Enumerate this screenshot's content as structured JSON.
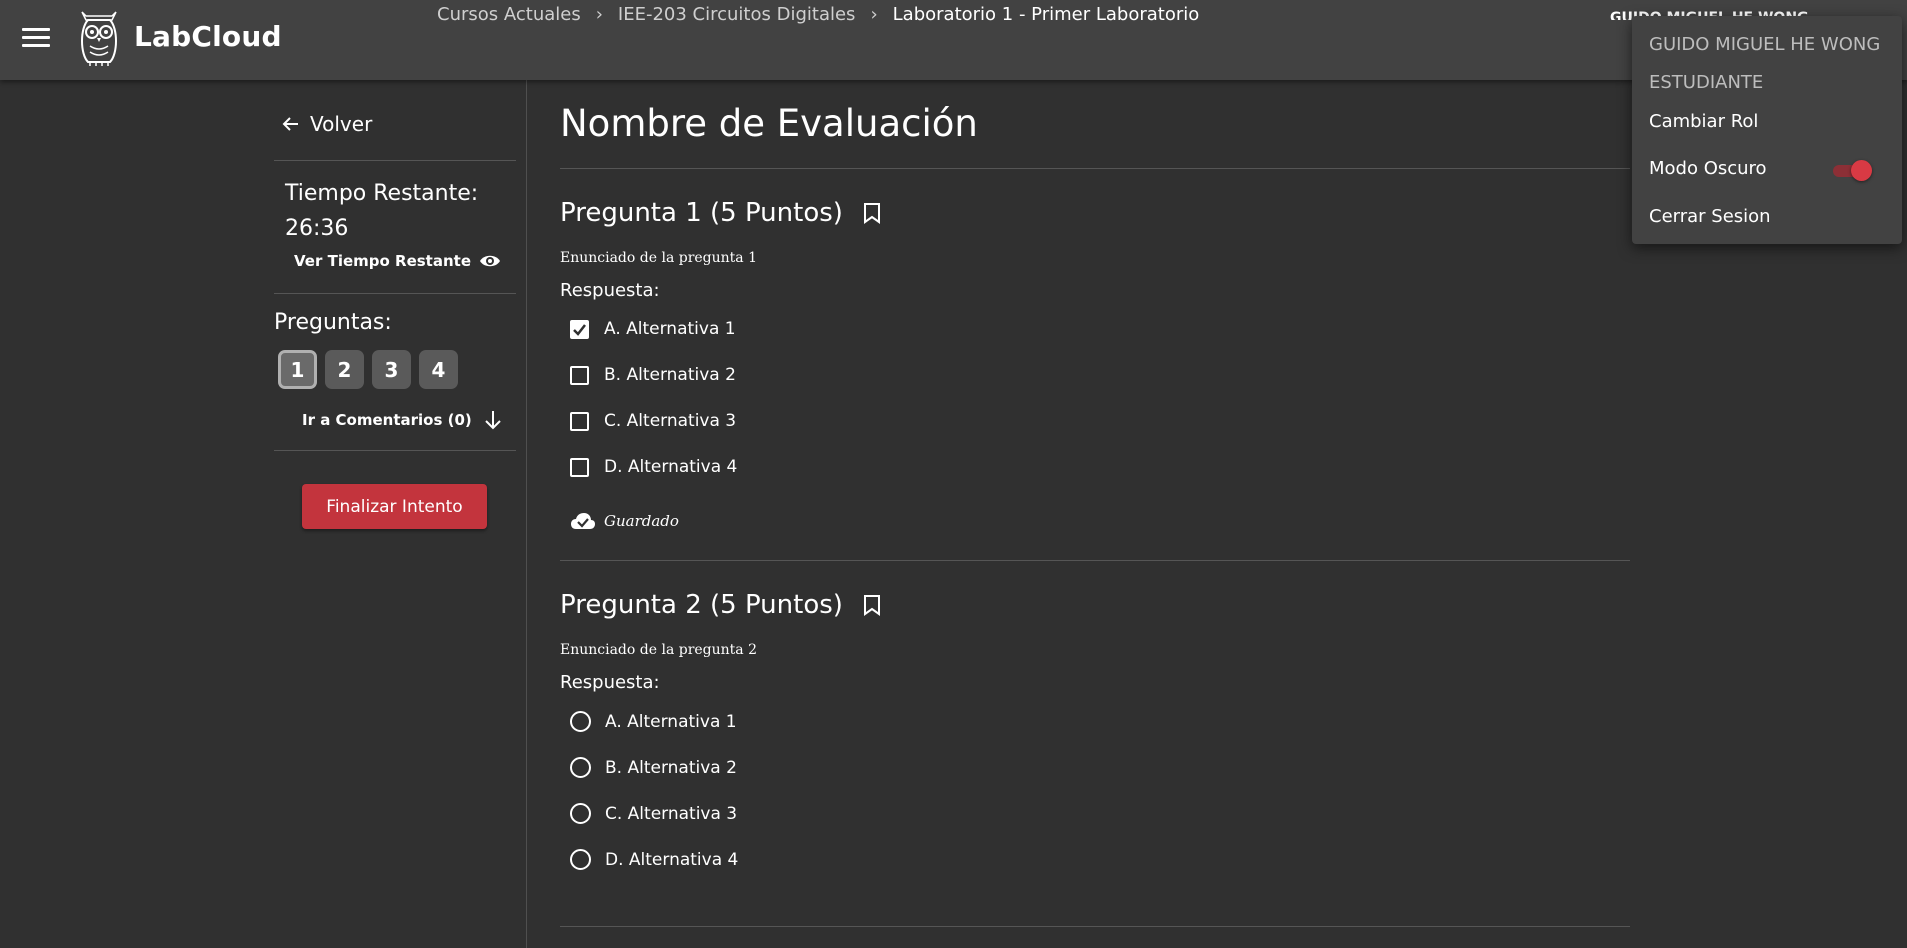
{
  "app": {
    "name": "LabCloud"
  },
  "breadcrumb": {
    "items": [
      "Cursos Actuales",
      "IEE-203 Circuitos Digitales",
      "Laboratorio 1 - Primer Laboratorio"
    ]
  },
  "header": {
    "user_name": "GUIDO MIGUEL HE WONG"
  },
  "sidebar": {
    "back_label": "Volver",
    "time_label": "Tiempo Restante:",
    "time_value": "26:36",
    "see_time_label": "Ver Tiempo Restante",
    "questions_label": "Preguntas:",
    "question_numbers": [
      "1",
      "2",
      "3",
      "4"
    ],
    "active_question": 1,
    "comments_label": "Ir a Comentarios (0)",
    "finish_label": "Finalizar Intento"
  },
  "main": {
    "title": "Nombre de Evaluación",
    "questions": [
      {
        "title": "Pregunta 1 (5 Puntos)",
        "statement": "Enunciado de la pregunta 1",
        "answer_label": "Respuesta:",
        "type": "checkbox",
        "options": [
          {
            "label": "A. Alternativa 1",
            "checked": true
          },
          {
            "label": "B. Alternativa 2",
            "checked": false
          },
          {
            "label": "C. Alternativa 3",
            "checked": false
          },
          {
            "label": "D. Alternativa 4",
            "checked": false
          }
        ],
        "status": "Guardado"
      },
      {
        "title": "Pregunta 2 (5 Puntos)",
        "statement": "Enunciado de la pregunta 2",
        "answer_label": "Respuesta:",
        "type": "radio",
        "options": [
          {
            "label": "A. Alternativa 1",
            "checked": false
          },
          {
            "label": "B. Alternativa 2",
            "checked": false
          },
          {
            "label": "C. Alternativa 3",
            "checked": false
          },
          {
            "label": "D. Alternativa 4",
            "checked": false
          }
        ]
      }
    ]
  },
  "user_menu": {
    "name": "GUIDO MIGUEL HE WONG",
    "role": "ESTUDIANTE",
    "change_role": "Cambiar Rol",
    "dark_mode": "Modo Oscuro",
    "dark_mode_on": true,
    "logout": "Cerrar Sesion"
  },
  "colors": {
    "background": "#303030",
    "topbar": "#424242",
    "accent": "#c3343d",
    "toggle": "#d83a44"
  }
}
